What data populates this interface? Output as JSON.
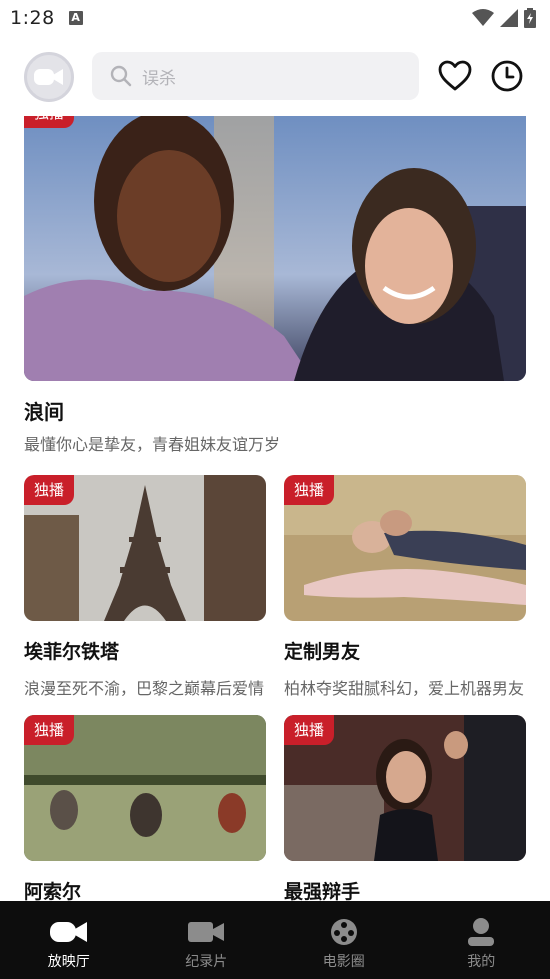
{
  "status_bar": {
    "time": "1:28",
    "indicator": "A"
  },
  "header": {
    "search_placeholder": "误杀"
  },
  "feature": {
    "badge": "独播",
    "title": "浪间",
    "description": "最懂你心是挚友，青春姐妹友谊万岁"
  },
  "cards": [
    {
      "badge": "独播",
      "title": "埃菲尔铁塔",
      "description": "浪漫至死不渝，巴黎之巅幕后爱情"
    },
    {
      "badge": "独播",
      "title": "定制男友",
      "description": "柏林夺奖甜腻科幻，爱上机器男友"
    },
    {
      "badge": "独播",
      "title": "阿索尔",
      "description": ""
    },
    {
      "badge": "独播",
      "title": "最强辩手",
      "description": ""
    }
  ],
  "nav": [
    {
      "label": "放映厅",
      "icon": "camera-icon",
      "active": true
    },
    {
      "label": "纪录片",
      "icon": "video-icon",
      "active": false
    },
    {
      "label": "电影圈",
      "icon": "film-reel-icon",
      "active": false
    },
    {
      "label": "我的",
      "icon": "person-icon",
      "active": false
    }
  ],
  "colors": {
    "badge": "#c91f2a",
    "nav_bg": "#0d0d0d"
  }
}
